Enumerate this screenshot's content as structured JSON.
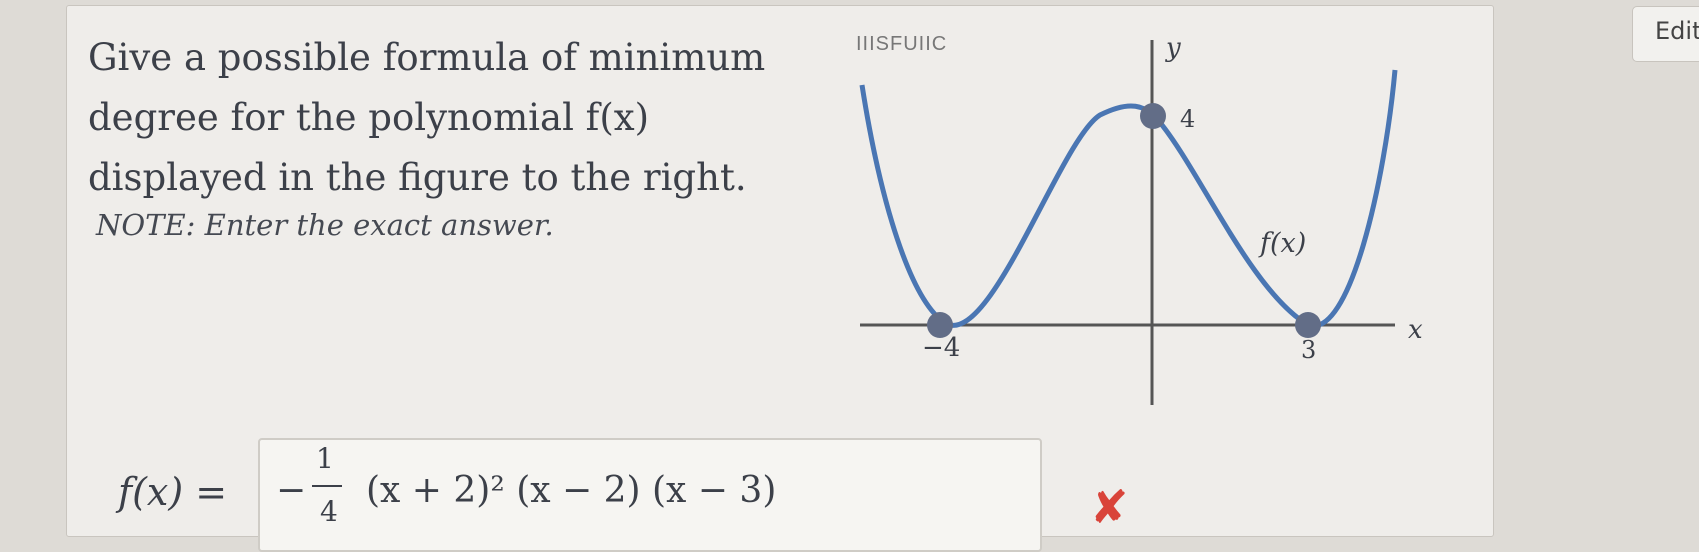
{
  "question": {
    "line1": "Give a possible formula of minimum",
    "line2": "degree for the polynomial f(x)",
    "line3": "displayed in the figure to the right.",
    "note": "NOTE: Enter the exact answer."
  },
  "graph": {
    "watermark": "IIISFUIIC",
    "y_axis_label": "y",
    "x_axis_label": "x",
    "function_label": "f(x)",
    "y_intercept_label": "4",
    "left_root_label": "−4",
    "right_root_label": "3",
    "curve_color": "#4a76b3",
    "point_color": "#626d87"
  },
  "answer": {
    "label": "f(x) =",
    "sign": "−",
    "frac_num": "1",
    "frac_den": "4",
    "expression": "(x + 2)² (x − 2) (x − 3)",
    "status_icon": "✘",
    "status_color": "#d9443a"
  },
  "toolbar": {
    "edit_label": "Edit"
  }
}
